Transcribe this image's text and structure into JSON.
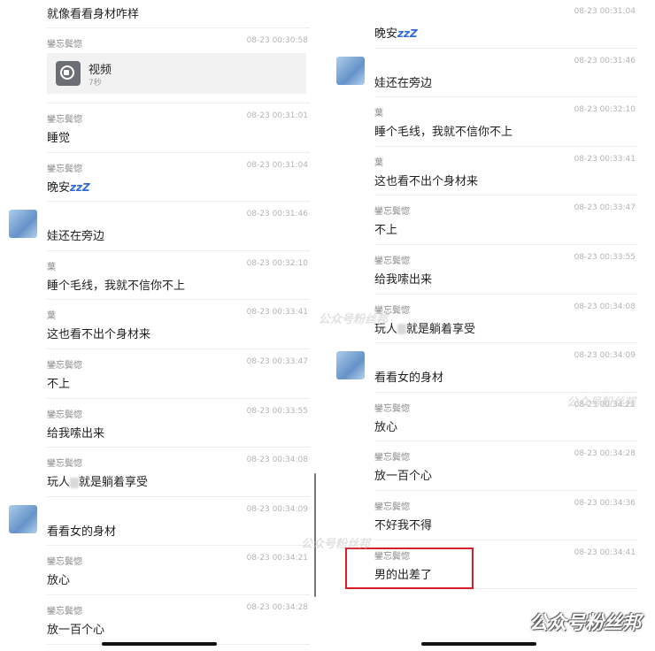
{
  "left": {
    "top_text": "就像看看身材咋样",
    "video": {
      "sender": "鑾忘鬓惚",
      "time": "08-23 00:30:58",
      "title": "视频",
      "duration": "7秒"
    },
    "messages": [
      {
        "sender": "鑾忘鬓惚",
        "time": "08-23 00:31:01",
        "text": "睡觉"
      },
      {
        "sender": "鑾忘鬓惚",
        "time": "08-23 00:31:04",
        "text": "晚安",
        "emoji": "zzZ"
      },
      {
        "sender": "",
        "time": "08-23 00:31:46",
        "text": "娃还在旁边",
        "avatar": true
      },
      {
        "sender": "葉",
        "time": "08-23 00:32:10",
        "text": "睡个毛线，我就不信你不上"
      },
      {
        "sender": "葉",
        "time": "08-23 00:33:41",
        "text": "这也看不出个身材来"
      },
      {
        "sender": "鑾忘鬓惚",
        "time": "08-23 00:33:47",
        "text": "不上"
      },
      {
        "sender": "鑾忘鬓惚",
        "time": "08-23 00:33:55",
        "text": "给我嗦出来"
      },
      {
        "sender": "鑾忘鬓惚",
        "time": "08-23 00:34:08",
        "text": "玩人",
        "text_after": "就是躺着享受"
      },
      {
        "sender": "",
        "time": "08-23 00:34:09",
        "text": "看看女的身材",
        "avatar": true
      },
      {
        "sender": "鑾忘鬓惚",
        "time": "08-23 00:34:21",
        "text": "放心"
      },
      {
        "sender": "鑾忘鬓惚",
        "time": "08-23 00:34:28",
        "text": "放一百个心"
      }
    ]
  },
  "right": {
    "messages": [
      {
        "sender": "",
        "time": "08-23 00:31:04",
        "text": "晚安",
        "emoji": "zzZ"
      },
      {
        "sender": "",
        "time": "08-23 00:31:46",
        "text": "娃还在旁边",
        "avatar": true
      },
      {
        "sender": "葉",
        "time": "08-23 00:32:10",
        "text": "睡个毛线，我就不信你不上"
      },
      {
        "sender": "葉",
        "time": "08-23 00:33:41",
        "text": "这也看不出个身材来"
      },
      {
        "sender": "鑾忘鬓惚",
        "time": "08-23 00:33:47",
        "text": "不上"
      },
      {
        "sender": "鑾忘鬓惚",
        "time": "08-23 00:33:55",
        "text": "给我嗦出来"
      },
      {
        "sender": "鑾忘鬓惚",
        "time": "08-23 00:34:08",
        "text": "玩人",
        "text_after": "就是躺着享受"
      },
      {
        "sender": "",
        "time": "08-23 00:34:09",
        "text": "看看女的身材",
        "avatar": true
      },
      {
        "sender": "鑾忘鬓惚",
        "time": "08-23 00:34:21",
        "text": "放心"
      },
      {
        "sender": "鑾忘鬓惚",
        "time": "08-23 00:34:28",
        "text": "放一百个心"
      },
      {
        "sender": "鑾忘鬓惚",
        "time": "08-23 00:34:36",
        "text": "不好我不得"
      },
      {
        "sender": "鑾忘鬓惚",
        "time": "08-23 00:34:41",
        "text": "男的出差了"
      }
    ]
  },
  "watermark": "公众号粉丝邦",
  "colors": {
    "highlight": "#d81e2a",
    "emoji": "#2f6bd6"
  }
}
